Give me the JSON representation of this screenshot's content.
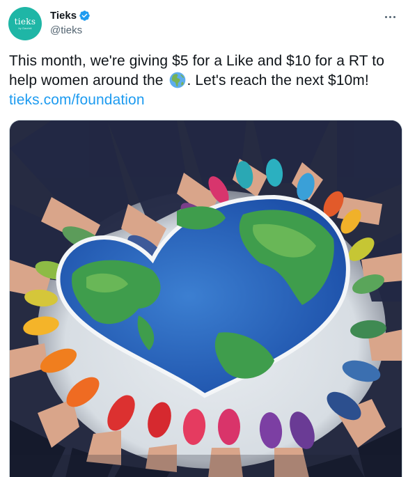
{
  "author": {
    "avatar_text": "tieks",
    "avatar_subtext": "by Gavrieli",
    "display_name": "Tieks",
    "handle": "@tieks",
    "verified": true
  },
  "tweet": {
    "text_part1": "This month, we're giving $5 for a Like and $10 for a RT to help women around the ",
    "emoji": "globe-americas",
    "text_part2": ". Let's reach the next $10m! ",
    "link_text": "tieks.com/foundation"
  },
  "media": {
    "alt": "Women's feet wearing colorful ballet flats arranged in a circle around a heart-shaped world map"
  },
  "colors": {
    "link": "#1d9bf0",
    "avatar_bg": "#1fb6a6",
    "verified": "#1d9bf0",
    "secondary_text": "#536471"
  }
}
